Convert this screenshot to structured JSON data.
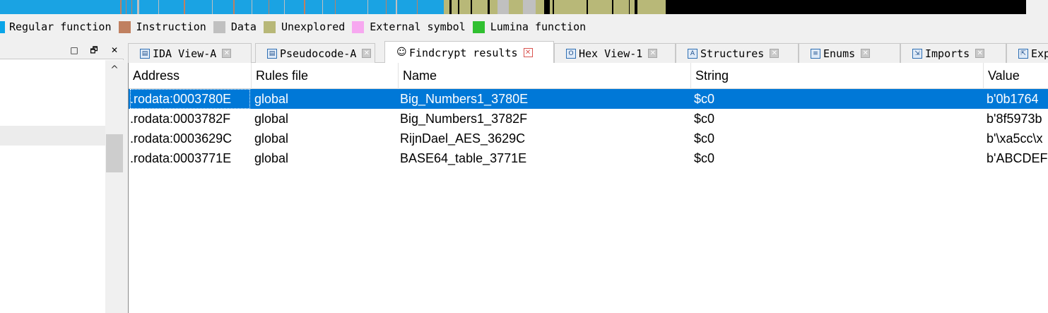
{
  "colors": {
    "regular_function": "#0aa5e8",
    "instruction": "#c08060",
    "data": "#c0c0c0",
    "unexplored": "#b8b878",
    "external_symbol": "#f7a8f0",
    "lumina_function": "#30c030",
    "selection": "#0078d7"
  },
  "legend": [
    {
      "label": "Regular function",
      "color": "#0aa5e8"
    },
    {
      "label": "Instruction",
      "color": "#c08060"
    },
    {
      "label": "Data",
      "color": "#c0c0c0"
    },
    {
      "label": "Unexplored",
      "color": "#b8b878"
    },
    {
      "label": "External symbol",
      "color": "#f7a8f0"
    },
    {
      "label": "Lumina function",
      "color": "#30c030"
    }
  ],
  "left_panel": {
    "restore_label": "□",
    "float_label": "🗗",
    "close_label": "✕",
    "scroll_up_label": "^"
  },
  "tabs": [
    {
      "label": "IDA View-A",
      "icon": "ida-view-icon",
      "glyph": "▤"
    },
    {
      "label": "Pseudocode-A",
      "icon": "pseudocode-icon",
      "glyph": "▤"
    },
    {
      "label": "Findcrypt results",
      "icon": "findcrypt-icon",
      "glyph": "☺"
    },
    {
      "label": "Hex View-1",
      "icon": "hex-view-icon",
      "glyph": "O"
    },
    {
      "label": "Structures",
      "icon": "structures-icon",
      "glyph": "A"
    },
    {
      "label": "Enums",
      "icon": "enums-icon",
      "glyph": "≡"
    },
    {
      "label": "Imports",
      "icon": "imports-icon",
      "glyph": "⇲"
    },
    {
      "label": "Exp",
      "icon": "exports-icon",
      "glyph": "⇱"
    }
  ],
  "tab_close_label": "✕",
  "table": {
    "columns": [
      "Address",
      "Rules file",
      "Name",
      "String",
      "Value"
    ],
    "rows": [
      [
        ".rodata:0003780E",
        "global",
        "Big_Numbers1_3780E",
        "$c0",
        "b'0b1764"
      ],
      [
        ".rodata:0003782F",
        "global",
        "Big_Numbers1_3782F",
        "$c0",
        "b'8f5973b"
      ],
      [
        ".rodata:0003629C",
        "global",
        "RijnDael_AES_3629C",
        "$c0",
        "b'\\xa5cc\\x"
      ],
      [
        ".rodata:0003771E",
        "global",
        "BASE64_table_3771E",
        "$c0",
        "b'ABCDEF"
      ]
    ]
  }
}
